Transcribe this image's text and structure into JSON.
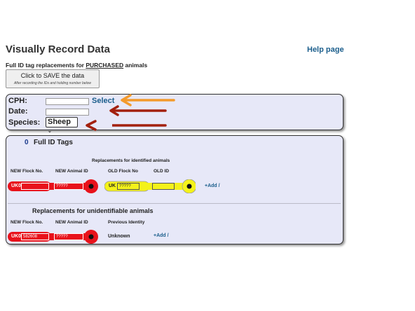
{
  "page": {
    "title": "Visually Record Data",
    "help_link": "Help page",
    "subtitle_pre": "Full ID tag replacements for ",
    "subtitle_em": "PURCHASED",
    "subtitle_post": " animals"
  },
  "save_button": {
    "label": "Click to SAVE the data",
    "hint": "After recording the IDs and holding number below"
  },
  "details": {
    "cph_label": "CPH:",
    "cph_value": "",
    "select_link": "Select",
    "date_label": "Date:",
    "date_value": "",
    "species_label": "Species:",
    "species_value": "Sheep"
  },
  "tags": {
    "count": "0",
    "heading": "Full ID Tags",
    "identified": {
      "heading": "Replacements for identified animals",
      "columns": [
        "NEW Flock No.",
        "NEW Animal ID",
        "OLD Flock No",
        "OLD ID"
      ],
      "new_prefix": "UK0",
      "new_flock": "",
      "new_animal": "?????",
      "old_prefix": "UK",
      "old_flock": "?????",
      "old_id": "",
      "add": "+Add /"
    },
    "unidentifiable": {
      "heading": "Replacements for unidentifiable animals",
      "columns": [
        "NEW Flock No.",
        "NEW Animal ID",
        "Previous Identity"
      ],
      "new_prefix": "UK0",
      "new_flock": "582608",
      "new_animal": "?????",
      "previous": "Unknown",
      "add": "+Add /"
    }
  },
  "colors": {
    "tag_red": "#e8121b",
    "tag_yellow": "#f4f21a",
    "arrow_orange": "#f39a2c",
    "arrow_dark_red": "#a3200e",
    "panel_bg": "#e7e8f8",
    "link_blue": "#1b5e8c"
  }
}
